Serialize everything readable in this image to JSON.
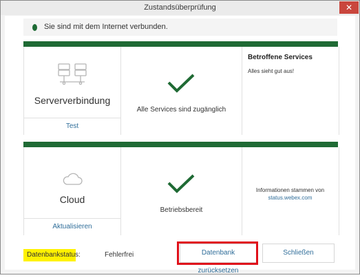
{
  "window": {
    "title": "Zustandsüberprüfung",
    "close_symbol": "✕"
  },
  "status": {
    "text": "Sie sind mit dem Internet verbunden.",
    "dot_color": "#1e6b35"
  },
  "server_panel": {
    "title": "Serververbindung",
    "action": "Test",
    "icon": "server-icon",
    "center_text": "Alle Services sind zugänglich",
    "side_title": "Betroffene Services",
    "side_text": "Alles sieht gut aus!"
  },
  "cloud_panel": {
    "title": "Cloud",
    "action": "Aktualisieren",
    "icon": "cloud-icon",
    "center_text": "Betriebsbereit",
    "info_text": "Informationen stammen von",
    "info_link": "status.webex.com"
  },
  "footer": {
    "db_status_label": "Datenbankstatus:",
    "db_status_value": "Fehlerfrei",
    "reset_button": "Datenbank zurücksetzen",
    "close_button": "Schließen"
  },
  "colors": {
    "accent_green": "#1f6a34",
    "link_blue": "#2f6d99",
    "highlight_yellow": "#fff200",
    "annotation_red": "#e0101a"
  }
}
